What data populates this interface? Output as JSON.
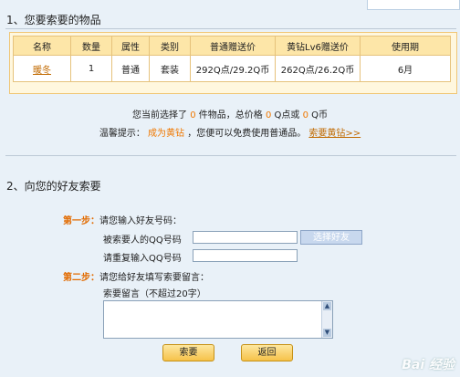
{
  "section1": {
    "title": "1、您要索要的物品"
  },
  "table": {
    "headers": [
      "名称",
      "数量",
      "属性",
      "类别",
      "普通赠送价",
      "黄钻Lv6赠送价",
      "使用期"
    ],
    "rows": [
      [
        "暖冬",
        "1",
        "普通",
        "套装",
        "292Q点/29.2Q币",
        "262Q点/26.2Q币",
        "6月"
      ]
    ]
  },
  "summary": {
    "prefix": "您当前选择了",
    "count": "0",
    "mid1": "件物品，总价格",
    "qpoints": "0",
    "mid2": "Q点或",
    "qcoins": "0",
    "suffix": "Q币"
  },
  "tip": {
    "label": "温馨提示：",
    "link1": "成为黄钻",
    "text": "，您便可以免费使用普通品。",
    "link2": "索要黄钻>>"
  },
  "section2": {
    "title": "2、向您的好友索要"
  },
  "step1": {
    "label": "第一步：",
    "text": "请您输入好友号码："
  },
  "fields": {
    "target_label": "被索要人的QQ号码",
    "repeat_label": "请重复输入QQ号码",
    "pick_friend": "选择好友"
  },
  "step2": {
    "label": "第二步：",
    "text": "请您给好友填写索要留言："
  },
  "message": {
    "label": "索要留言（不超过20字）"
  },
  "buttons": {
    "request": "索要",
    "back": "返回"
  },
  "watermark": "Bai 经验"
}
